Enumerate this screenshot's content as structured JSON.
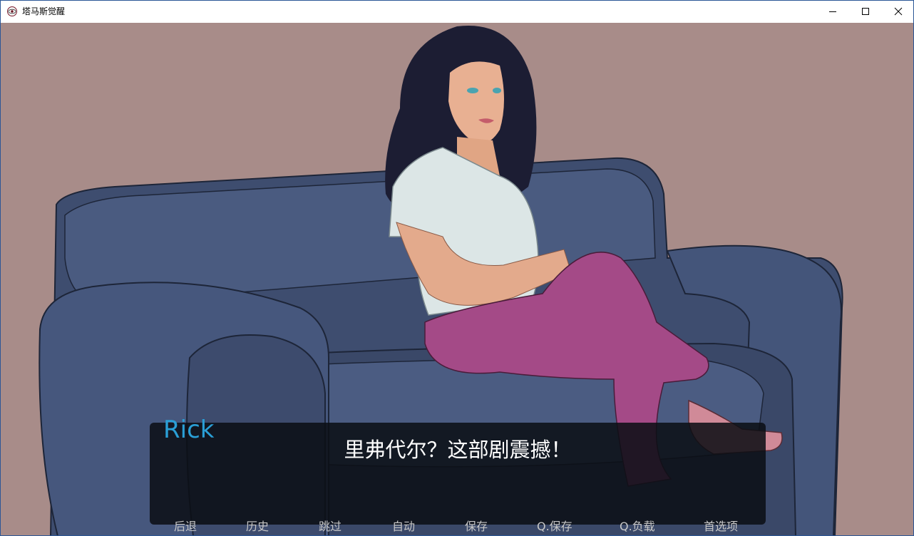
{
  "window": {
    "title": "塔马斯觉醒",
    "app_icon": "eye-icon",
    "controls": {
      "minimize_icon": "minimize-icon",
      "maximize_icon": "maximize-icon",
      "close_icon": "close-icon"
    }
  },
  "scene": {
    "background_color": "#a88c89",
    "sofa_color": "#3e4d6f",
    "character_top_color": "#dce6e6",
    "character_pants_color": "#a44a87",
    "character_hair_color": "#1c1d33"
  },
  "dialogue": {
    "speaker": "Rick",
    "speaker_color": "#2a9fd6",
    "text": "里弗代尔？这部剧震撼！"
  },
  "quick_menu": {
    "items": [
      {
        "label": "后退"
      },
      {
        "label": "历史"
      },
      {
        "label": "跳过"
      },
      {
        "label": "自动"
      },
      {
        "label": "保存"
      },
      {
        "label": "Q.保存"
      },
      {
        "label": "Q.负载"
      },
      {
        "label": "首选项"
      }
    ]
  }
}
